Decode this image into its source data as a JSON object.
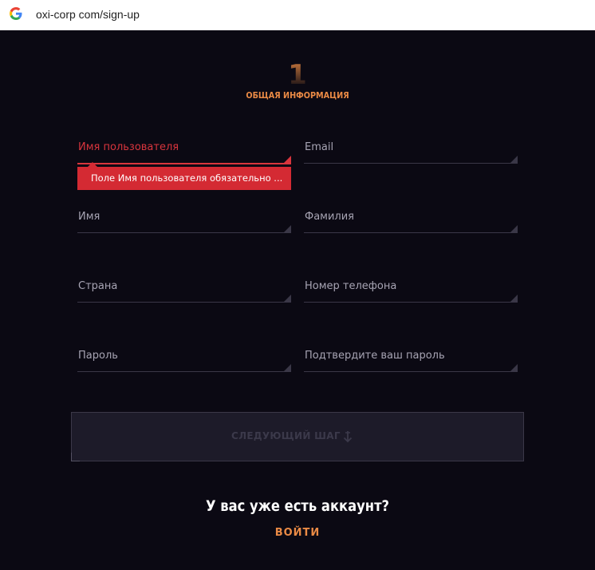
{
  "browser": {
    "url": "oxi-corp com/sign-up",
    "favicon": "google-g-icon"
  },
  "step": {
    "number": "1",
    "title": "ОБЩАЯ ИНФОРМАЦИЯ"
  },
  "form": {
    "username_label": "Имя пользователя",
    "username_error": "Поле Имя пользователя обязательно ...",
    "email_label": "Email",
    "first_name_label": "Имя",
    "last_name_label": "Фамилия",
    "country_label": "Страна",
    "phone_label": "Номер телефона",
    "password_label": "Пароль",
    "confirm_password_label": "Подтвердите ваш пароль"
  },
  "next_button": {
    "label": "СЛЕДУЮЩИЙ ШАГ",
    "icon": "anchor-arrow-icon"
  },
  "footer": {
    "have_account": "У вас уже есть аккаунт?",
    "login_label": "ВОЙТИ"
  },
  "colors": {
    "background": "#0b0913",
    "accent": "#ea8a45",
    "error": "#d42a33",
    "field_line": "#3a3747"
  }
}
